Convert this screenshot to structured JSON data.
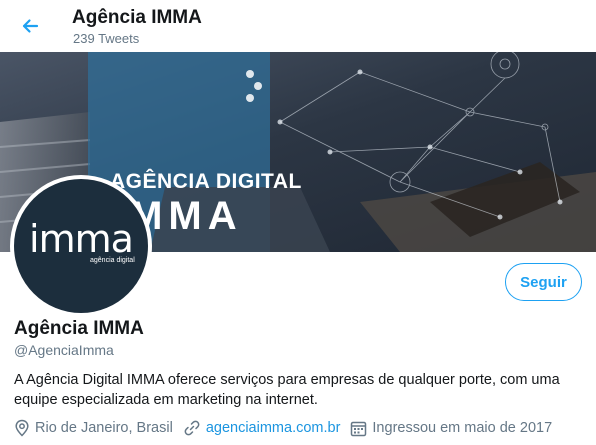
{
  "header": {
    "title": "Agência IMMA",
    "subtitle": "239 Tweets"
  },
  "banner": {
    "line1": "AGÊNCIA DIGITAL",
    "line2": "IMMA"
  },
  "avatar": {
    "logo_word": "imma",
    "logo_sub": "agência digital"
  },
  "actions": {
    "follow_label": "Seguir"
  },
  "profile": {
    "name": "Agência IMMA",
    "handle": "@AgenciaImma",
    "bio": "A Agência Digital IMMA oferece serviços para empresas de qualquer porte, com uma equipe especializada em marketing na internet.",
    "location": "Rio de Janeiro, Brasil",
    "website": "agenciaimma.com.br",
    "joined": "Ingressou em maio de 2017"
  },
  "colors": {
    "accent": "#1da1f2",
    "link": "#1b95e0",
    "secondary_text": "#657786",
    "avatar_bg": "#1c2e3d"
  },
  "icons": {
    "back": "arrow-left-icon",
    "location": "location-pin-icon",
    "website": "link-icon",
    "joined": "calendar-icon"
  }
}
